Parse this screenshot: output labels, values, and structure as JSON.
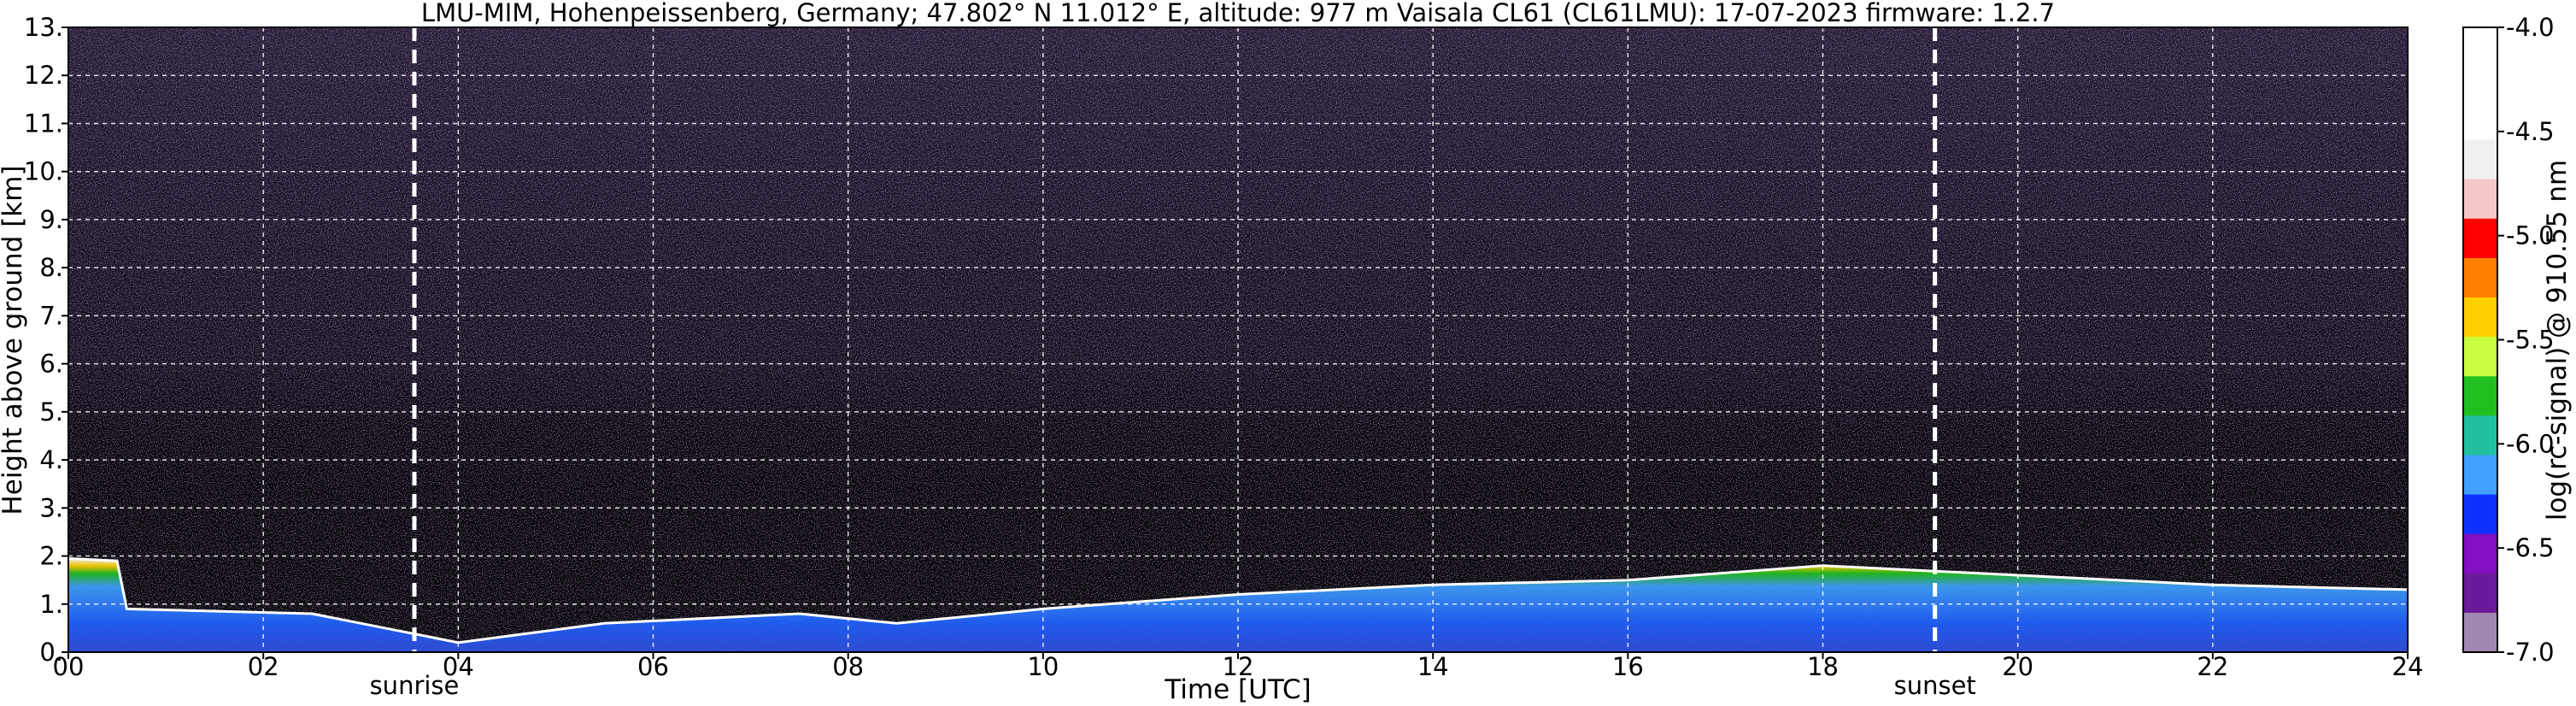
{
  "chart_data": {
    "type": "heatmap",
    "title": "LMU-MIM, Hohenpeissenberg, Germany; 47.802° N 11.012° E, altitude: 977 m    Vaisala CL61 (CL61LMU): 17-07-2023    firmware: 1.2.7",
    "xlabel": "Time [UTC]",
    "ylabel": "Height above ground [km]",
    "xlim": [
      0,
      24
    ],
    "ylim": [
      0,
      13
    ],
    "x_ticks": [
      "00",
      "02",
      "04",
      "06",
      "08",
      "10",
      "12",
      "14",
      "16",
      "18",
      "20",
      "22",
      "24"
    ],
    "y_ticks": [
      "0.",
      "1.",
      "2.",
      "3.",
      "4.",
      "5.",
      "6.",
      "7.",
      "8.",
      "9.",
      "10.",
      "11.",
      "12.",
      "13."
    ],
    "grid": true,
    "colorbar": {
      "label": "log(rc-signal) @ 910.55 nm",
      "range": [
        -7.0,
        -4.0
      ],
      "ticks": [
        "-4.0",
        "-4.5",
        "-5.0",
        "-5.5",
        "-6.0",
        "-6.5",
        "-7.0"
      ]
    },
    "markers": [
      {
        "label": "sunrise",
        "time": 3.55
      },
      {
        "label": "sunset",
        "time": 19.15
      }
    ],
    "boundary_layer_top_km": [
      {
        "t": 0.0,
        "h": 1.95
      },
      {
        "t": 0.5,
        "h": 1.9
      },
      {
        "t": 0.6,
        "h": 0.9
      },
      {
        "t": 2.5,
        "h": 0.8
      },
      {
        "t": 4.0,
        "h": 0.2
      },
      {
        "t": 5.5,
        "h": 0.6
      },
      {
        "t": 7.5,
        "h": 0.8
      },
      {
        "t": 8.5,
        "h": 0.6
      },
      {
        "t": 10.0,
        "h": 0.9
      },
      {
        "t": 12.0,
        "h": 1.2
      },
      {
        "t": 14.0,
        "h": 1.4
      },
      {
        "t": 16.0,
        "h": 1.5
      },
      {
        "t": 18.0,
        "h": 1.8
      },
      {
        "t": 20.0,
        "h": 1.6
      },
      {
        "t": 22.0,
        "h": 1.4
      },
      {
        "t": 24.0,
        "h": 1.3
      }
    ],
    "colormap": [
      "#f0f0f0",
      "#f4c8c8",
      "#ff0000",
      "#ff8000",
      "#ffd000",
      "#c8ff40",
      "#20c020",
      "#20c0a0",
      "#40a0ff",
      "#1030ff",
      "#8010c0",
      "#6a1a9a",
      "#a088b0"
    ]
  }
}
